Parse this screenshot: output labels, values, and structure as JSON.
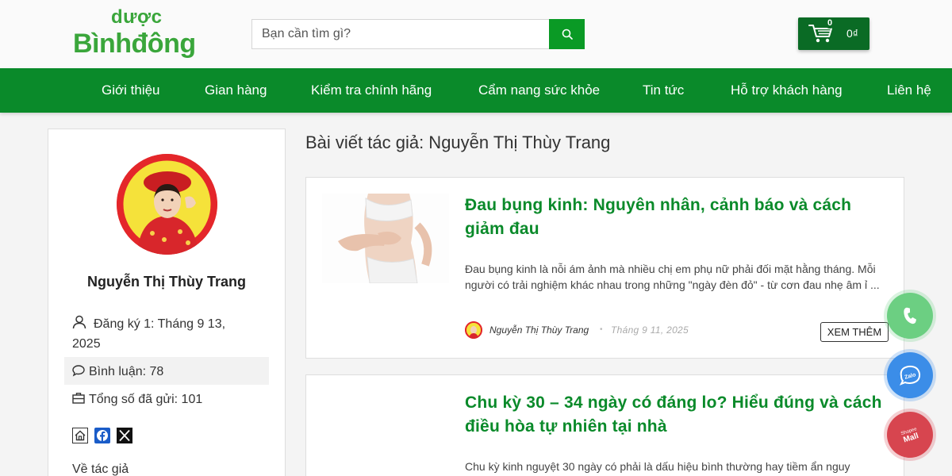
{
  "header": {
    "logo_top": "dược",
    "logo_bottom": "Bìnhđông",
    "search_placeholder": "Bạn cần tìm gì?",
    "cart_count": "0",
    "cart_total": "0₫"
  },
  "nav": {
    "items": [
      "Giới thiệu",
      "Gian hàng",
      "Kiểm tra chính hãng",
      "Cẩm nang sức khỏe",
      "Tin tức",
      "Hỗ trợ khách hàng",
      "Liên hệ"
    ]
  },
  "sidebar": {
    "author_name": "Nguyễn Thị Thùy Trang",
    "registered_line1": "Đăng ký 1: Tháng 9 13,",
    "registered_line2": "2025",
    "comments": "Bình luận: 78",
    "total_posts": "Tổng số đã gửi: 101",
    "about_title": "Về tác giả"
  },
  "main": {
    "title": "Bài viết tác giả: Nguyễn Thị Thùy Trang",
    "posts": [
      {
        "title": "Đau bụng kinh: Nguyên nhân, cảnh báo và cách giảm đau",
        "excerpt": "Đau bụng kinh là nỗi ám ảnh mà nhiều chị em phụ nữ phải đối mặt hằng tháng. Mỗi người có trải nghiệm khác nhau trong những \"ngày đèn đỏ\" - từ cơn đau nhẹ âm ỉ ...",
        "author": "Nguyễn Thị Thùy Trang",
        "date": "Tháng 9 11, 2025",
        "read_more": "XEM THÊM"
      },
      {
        "title": "Chu kỳ 30 – 34 ngày có đáng lo? Hiểu đúng và cách điều hòa tự nhiên tại nhà",
        "excerpt": "Chu kỳ kinh nguyệt 30 ngày có phải là dấu hiệu bình thường hay tiềm ẩn nguy"
      }
    ]
  },
  "floating": {
    "zalo_label": "Zalo",
    "shopee_label_1": "Shopee",
    "shopee_label_2": "Mall"
  },
  "colors": {
    "brand_green": "#0a8a2a",
    "logo_green": "#3aa63b",
    "cart_green": "#0a6b25"
  }
}
